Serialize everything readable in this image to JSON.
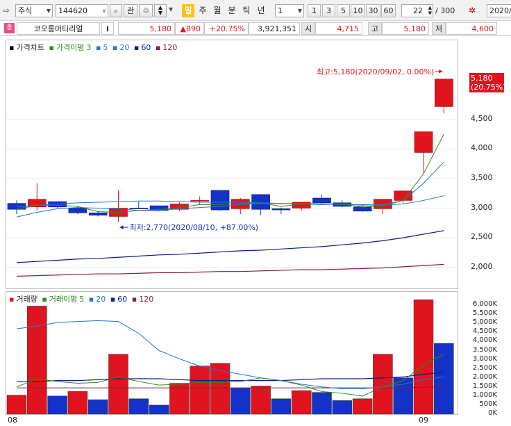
{
  "toolbar": {
    "market": "주식",
    "code": "144620",
    "gwan": "관",
    "periods": [
      "일",
      "주",
      "월",
      "분",
      "틱",
      "년"
    ],
    "active_period": "일",
    "interval": "1",
    "intervals": [
      "1",
      "3",
      "5",
      "10",
      "30",
      "60"
    ],
    "count": "22",
    "total": "/ 300",
    "date": "2020/"
  },
  "info": {
    "icon_label": "종",
    "name": "코오롱머티리얼",
    "info_btn": "i",
    "price": "5,180",
    "change": "▲890",
    "rate": "+20.75%",
    "volume": "3,921,351",
    "open_label": "시",
    "open": "4,715",
    "high_label": "고",
    "high": "5,180",
    "low_label": "저",
    "low": "4,600"
  },
  "colors": {
    "up": "#e0141e",
    "down": "#1432c8",
    "ma3": "#2f8a1e",
    "ma5": "#1e78d2",
    "ma20": "#1e78d2",
    "ma60": "#0a1e8c",
    "ma120": "#8c1e3c"
  },
  "price_legend": {
    "title": "가격차트",
    "ma": "가격이평",
    "p3": "3",
    "p5": "5",
    "p20": "20",
    "p60": "60",
    "p120": "120"
  },
  "vol_legend": {
    "title": "거래량",
    "ma": "거래이평",
    "p5": "5",
    "p20": "20",
    "p60": "60",
    "p120": "120"
  },
  "price_annotations": {
    "high": "최고:5,180(2020/09/02, 0.00%)",
    "low": "최저:2,770(2020/08/10, +87.00%)",
    "last_price": "5,180",
    "last_rate": "(20.75%)"
  },
  "x_labels": [
    "08",
    "09"
  ],
  "chart_data": [
    {
      "type": "candlestick",
      "title": "가격차트",
      "ylim": [
        1750,
        5600
      ],
      "yticks": [
        "4,500",
        "4,000",
        "3,500",
        "3,000",
        "2,500",
        "2,000"
      ],
      "ytick_values": [
        4500,
        4000,
        3500,
        3000,
        2500,
        2000
      ],
      "candles": [
        {
          "o": 3080,
          "h": 3130,
          "l": 2900,
          "c": 2980
        },
        {
          "o": 3020,
          "h": 3420,
          "l": 2960,
          "c": 3150
        },
        {
          "o": 3110,
          "h": 3110,
          "l": 3000,
          "c": 3020
        },
        {
          "o": 3000,
          "h": 3030,
          "l": 2900,
          "c": 2920
        },
        {
          "o": 2920,
          "h": 2960,
          "l": 2860,
          "c": 2880
        },
        {
          "o": 2860,
          "h": 3300,
          "l": 2770,
          "c": 3000
        },
        {
          "o": 3000,
          "h": 3110,
          "l": 2990,
          "c": 2990
        },
        {
          "o": 3040,
          "h": 3040,
          "l": 2950,
          "c": 2960
        },
        {
          "o": 2980,
          "h": 3100,
          "l": 2950,
          "c": 3070
        },
        {
          "o": 3130,
          "h": 3200,
          "l": 3060,
          "c": 3130
        },
        {
          "o": 3300,
          "h": 3300,
          "l": 2960,
          "c": 2970
        },
        {
          "o": 2990,
          "h": 3170,
          "l": 2900,
          "c": 3150
        },
        {
          "o": 3230,
          "h": 3230,
          "l": 2880,
          "c": 2980
        },
        {
          "o": 2990,
          "h": 3010,
          "l": 2900,
          "c": 2970
        },
        {
          "o": 3000,
          "h": 3100,
          "l": 2960,
          "c": 3100
        },
        {
          "o": 3170,
          "h": 3220,
          "l": 3080,
          "c": 3090
        },
        {
          "o": 3090,
          "h": 3130,
          "l": 3020,
          "c": 3030
        },
        {
          "o": 3020,
          "h": 3050,
          "l": 2940,
          "c": 2950
        },
        {
          "o": 2990,
          "h": 3130,
          "l": 2900,
          "c": 3150
        },
        {
          "o": 3130,
          "h": 3300,
          "l": 3080,
          "c": 3290
        },
        {
          "o": 3940,
          "h": 4290,
          "l": 3600,
          "c": 4290
        },
        {
          "o": 4715,
          "h": 5180,
          "l": 4600,
          "c": 5180
        }
      ],
      "ma3": [
        2990,
        3040,
        3050,
        3030,
        2940,
        2930,
        2960,
        2980,
        3010,
        3060,
        3060,
        3080,
        3090,
        3030,
        3070,
        3070,
        3070,
        3020,
        3040,
        3130,
        3580,
        4250
      ],
      "ma5": [
        2850,
        2930,
        2990,
        3010,
        3000,
        2990,
        2960,
        2960,
        2990,
        3010,
        3030,
        3060,
        3080,
        3080,
        3070,
        3060,
        3070,
        3050,
        3060,
        3130,
        3420,
        3780
      ],
      "ma20": [
        3020,
        3050,
        3070,
        3090,
        3100,
        3110,
        3120,
        3120,
        3110,
        3100,
        3100,
        3100,
        3090,
        3080,
        3080,
        3070,
        3060,
        3060,
        3050,
        3070,
        3130,
        3210
      ],
      "ma60": [
        2080,
        2100,
        2120,
        2140,
        2150,
        2170,
        2190,
        2210,
        2220,
        2240,
        2260,
        2280,
        2290,
        2310,
        2330,
        2350,
        2380,
        2410,
        2450,
        2500,
        2560,
        2620
      ],
      "ma120": [
        1850,
        1860,
        1870,
        1880,
        1890,
        1890,
        1900,
        1910,
        1910,
        1920,
        1930,
        1930,
        1940,
        1950,
        1960,
        1960,
        1970,
        1980,
        1990,
        2010,
        2030,
        2050
      ]
    },
    {
      "type": "bar",
      "title": "거래량",
      "ylim": [
        0,
        6350
      ],
      "yticks": [
        "6,000K",
        "5,500K",
        "5,000K",
        "4,500K",
        "4,000K",
        "3,500K",
        "3,000K",
        "2,500K",
        "2,000K",
        "1,500K",
        "1,000K",
        "500K",
        "0K"
      ],
      "ytick_values": [
        6000,
        5500,
        5000,
        4500,
        4000,
        3500,
        3000,
        2500,
        2000,
        1500,
        1000,
        500,
        0
      ],
      "values": [
        1050,
        5950,
        1000,
        1250,
        800,
        3300,
        850,
        500,
        1700,
        2650,
        2800,
        1450,
        1550,
        850,
        1300,
        1200,
        750,
        850,
        3300,
        2000,
        6300,
        3900
      ],
      "up": [
        true,
        true,
        false,
        true,
        false,
        true,
        false,
        false,
        true,
        true,
        true,
        false,
        true,
        false,
        true,
        false,
        false,
        true,
        true,
        false,
        true,
        false
      ],
      "ma5": [
        1500,
        1950,
        1800,
        1700,
        1750,
        2050,
        1800,
        1600,
        1650,
        1750,
        1750,
        1800,
        2000,
        1850,
        1600,
        1250,
        1150,
        1000,
        1500,
        1850,
        2700,
        3300
      ],
      "ma20": [
        4700,
        4850,
        5050,
        5100,
        5150,
        5100,
        4450,
        3500,
        3050,
        2650,
        2400,
        2200,
        2000,
        1850,
        1650,
        1500,
        1400,
        1400,
        1500,
        1650,
        1900,
        2050
      ],
      "ma60": [
        1800,
        1800,
        1850,
        1850,
        1900,
        1950,
        1950,
        1950,
        1900,
        1850,
        1850,
        1850,
        1850,
        1850,
        1900,
        1950,
        1950,
        1950,
        2000,
        2050,
        2200,
        2300
      ],
      "ma120": [
        1450,
        1450,
        1450,
        1450,
        1450,
        1450,
        1450,
        1450,
        1450,
        1450,
        1450,
        1450,
        1450,
        1450,
        1450,
        1450,
        1450,
        1450,
        1450,
        1450,
        1480,
        1500
      ]
    }
  ]
}
